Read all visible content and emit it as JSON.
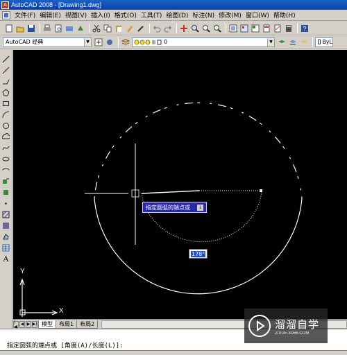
{
  "window": {
    "title": "AutoCAD 2008 - [Drawing1.dwg]"
  },
  "menu": {
    "items": [
      "文件(F)",
      "编辑(E)",
      "视图(V)",
      "插入(I)",
      "格式(O)",
      "工具(T)",
      "绘图(D)",
      "标注(N)",
      "修改(M)",
      "窗口(W)",
      "帮助(H)"
    ]
  },
  "toolbar2": {
    "workspace_value": "AutoCAD 经典",
    "layer_value": "0",
    "bylayer_label": "ByL"
  },
  "canvas": {
    "tooltip_text": "指定圆弧的端点或",
    "tooltip_button": "↓",
    "angle_value": "178°",
    "ucs_x_label": "X",
    "ucs_y_label": "Y"
  },
  "tabs": {
    "items": [
      "模型",
      "布局1",
      "布局2"
    ],
    "active": "模型"
  },
  "command": {
    "prompt": "指定圆弧的端点或 [角度(A)/长度(L)]:"
  },
  "watermark": {
    "brand": "溜溜自学",
    "url": "ZIXUE.3D66.COM"
  },
  "colors": {
    "canvas_bg": "#000000",
    "title_bar": "#0a3fa6",
    "tooltip_bg": "#2a2aa8"
  }
}
